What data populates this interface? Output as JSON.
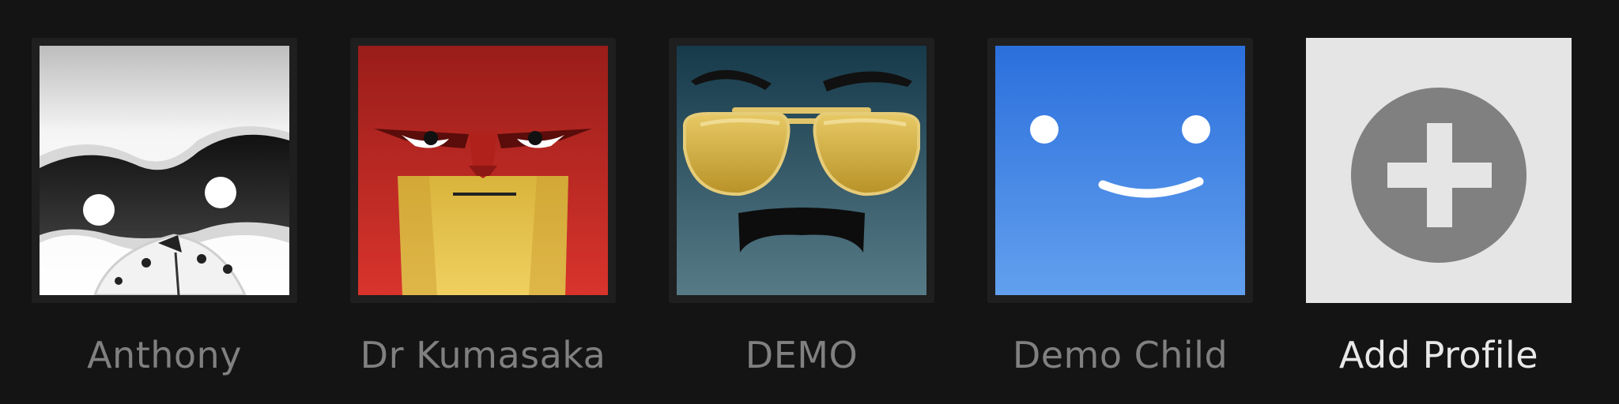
{
  "profiles": [
    {
      "name": "Anthony",
      "icon": "panda-avatar-icon"
    },
    {
      "name": "Dr Kumasaka",
      "icon": "red-angry-face-avatar-icon"
    },
    {
      "name": "DEMO",
      "icon": "sunglasses-mustache-avatar-icon"
    },
    {
      "name": "Demo Child",
      "icon": "blue-smiley-avatar-icon"
    }
  ],
  "add_profile": {
    "label": "Add Profile",
    "icon": "plus-circle-icon"
  },
  "colors": {
    "background": "#141414",
    "profile_name": "#808080",
    "add_profile_label": "#e8e8e8",
    "smiley_blue": "#2b74e0",
    "kumasaka_red": "#d0302a",
    "demo_teal": "#2c4a58",
    "add_tile": "#e5e5e5",
    "add_circle": "#808080"
  }
}
